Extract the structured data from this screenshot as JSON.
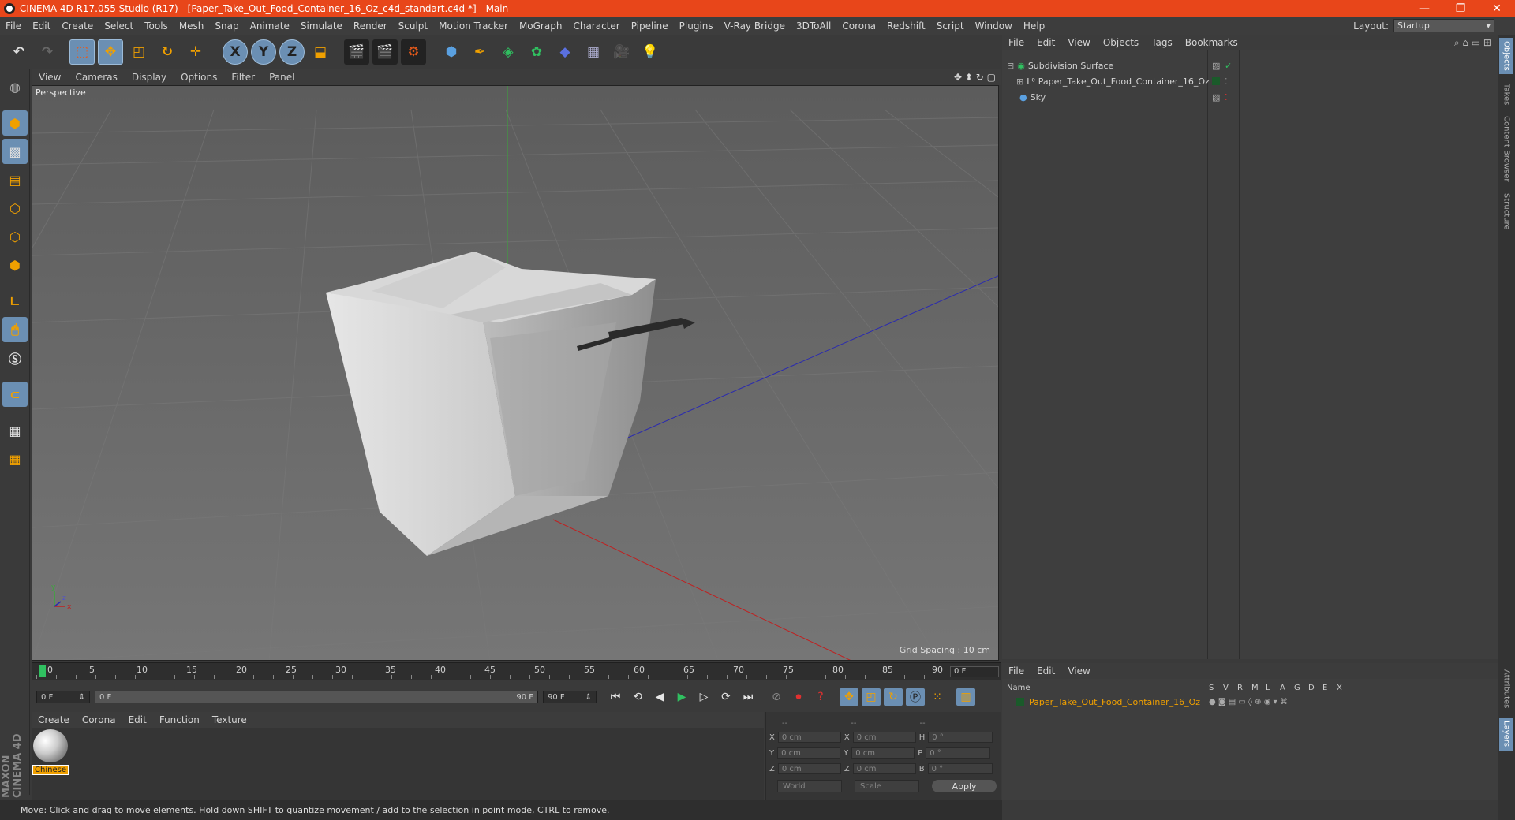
{
  "window": {
    "title": "CINEMA 4D R17.055 Studio (R17) - [Paper_Take_Out_Food_Container_16_Oz_c4d_standart.c4d *] - Main",
    "min": "—",
    "max": "❐",
    "close": "✕"
  },
  "menu": [
    "File",
    "Edit",
    "Create",
    "Select",
    "Tools",
    "Mesh",
    "Snap",
    "Animate",
    "Simulate",
    "Render",
    "Sculpt",
    "Motion Tracker",
    "MoGraph",
    "Character",
    "Pipeline",
    "Plugins",
    "V-Ray Bridge",
    "3DToAll",
    "Corona",
    "Redshift",
    "Script",
    "Window",
    "Help"
  ],
  "layout": {
    "label": "Layout:",
    "value": "Startup"
  },
  "toolbar": {
    "x": "X",
    "y": "Y",
    "z": "Z"
  },
  "viewport": {
    "menu": [
      "View",
      "Cameras",
      "Display",
      "Options",
      "Filter",
      "Panel"
    ],
    "label": "Perspective",
    "grid_spacing": "Grid Spacing : 10 cm",
    "nav_icons": "✥ ⬍ ↻ ▢"
  },
  "timeline": {
    "ticks": [
      "0",
      "5",
      "10",
      "15",
      "20",
      "25",
      "30",
      "35",
      "40",
      "45",
      "50",
      "55",
      "60",
      "65",
      "70",
      "75",
      "80",
      "85",
      "90"
    ],
    "current": "0 F"
  },
  "transport": {
    "start": "0 F",
    "range_start": "0 F",
    "range_end": "90 F",
    "end": "90 F"
  },
  "material": {
    "menu": [
      "Create",
      "Corona",
      "Edit",
      "Function",
      "Texture"
    ],
    "name": "Chinese"
  },
  "coords": {
    "header": [
      "--",
      "--",
      "--"
    ],
    "rows": [
      {
        "a": "X",
        "v1": "0 cm",
        "b": "X",
        "v2": "0 cm",
        "c": "H",
        "v3": "0 °"
      },
      {
        "a": "Y",
        "v1": "0 cm",
        "b": "Y",
        "v2": "0 cm",
        "c": "P",
        "v3": "0 °"
      },
      {
        "a": "Z",
        "v1": "0 cm",
        "b": "Z",
        "v2": "0 cm",
        "c": "B",
        "v3": "0 °"
      }
    ],
    "mode": "World",
    "type": "Scale",
    "apply": "Apply"
  },
  "status": "Move: Click and drag to move elements. Hold down SHIFT to quantize movement / add to the selection in point mode, CTRL to remove.",
  "objects": {
    "menu": [
      "File",
      "Edit",
      "View",
      "Objects",
      "Tags",
      "Bookmarks"
    ],
    "items": [
      "Subdivision Surface",
      "Paper_Take_Out_Food_Container_16_Oz",
      "Sky"
    ]
  },
  "layers": {
    "menu": [
      "File",
      "Edit",
      "View"
    ],
    "columns": [
      "Name",
      "S",
      "V",
      "R",
      "M",
      "L",
      "A",
      "G",
      "D",
      "E",
      "X"
    ],
    "item": "Paper_Take_Out_Food_Container_16_Oz"
  },
  "sidetabs": [
    "Objects",
    "Takes",
    "Content Browser",
    "Structure",
    "Attributes",
    "Layers"
  ],
  "brand": "MAXON CINEMA 4D",
  "colors": {
    "titlebar": "#e8461a",
    "accent": "#6b8fb3",
    "selection": "#f0a000"
  }
}
